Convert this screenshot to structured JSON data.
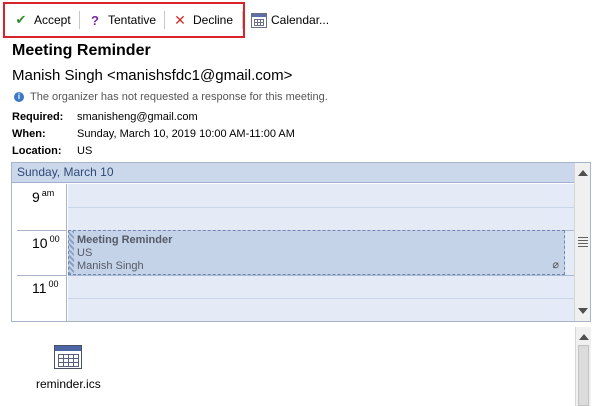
{
  "toolbar": {
    "accept_label": "Accept",
    "tentative_label": "Tentative",
    "decline_label": "Decline",
    "calendar_label": "Calendar...",
    "highlight_color": "#d9232b"
  },
  "message": {
    "subject": "Meeting Reminder",
    "sender": "Manish Singh <manishsfdc1@gmail.com>",
    "info_text": "The organizer has not requested a response for this meeting.",
    "required_label": "Required:",
    "required_value": "smanisheng@gmail.com",
    "when_label": "When:",
    "when_value": "Sunday, March 10, 2019 10:00 AM-11:00 AM",
    "location_label": "Location:",
    "location_value": "US"
  },
  "calendar": {
    "date_header": "Sunday, March 10",
    "hours": [
      {
        "hour": "9",
        "suffix": "am"
      },
      {
        "hour": "10",
        "suffix": "00"
      },
      {
        "hour": "11",
        "suffix": "00"
      }
    ],
    "appointment": {
      "title": "Meeting Reminder",
      "location": "US",
      "organizer": "Manish Singh"
    }
  },
  "attachment": {
    "filename": "reminder.ics",
    "icon": "calendar-file-icon"
  },
  "icons": {
    "accept": "checkmark-icon",
    "tentative": "question-mark-icon",
    "decline": "x-icon",
    "calendar": "calendar-icon",
    "info": "info-icon",
    "attachment": "paperclip-icon"
  }
}
